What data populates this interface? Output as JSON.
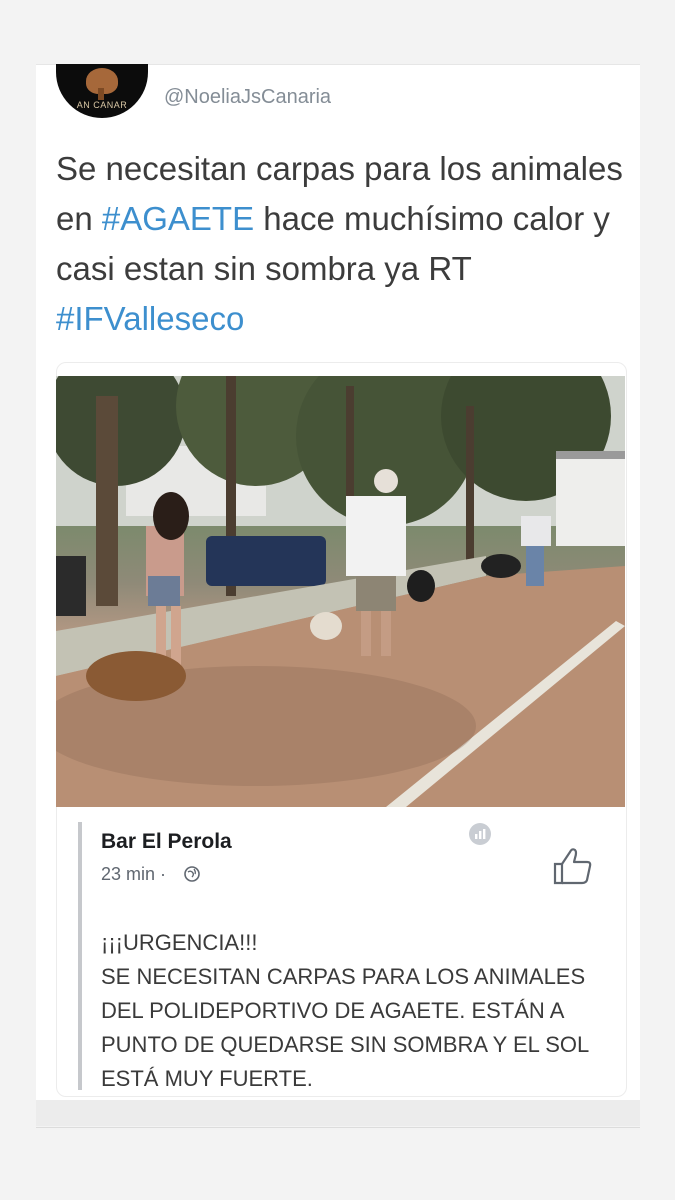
{
  "tweet": {
    "handle": "@NoeliaJsCanaria",
    "avatar_text": "AN CANAR",
    "text_prefix": "Se necesitan carpas para los animales en ",
    "hashtag1": "#AGAETE",
    "text_middle": " hace muchísimo calor y casi estan sin sombra ya RT  ",
    "hashtag2": "#IFValleseco"
  },
  "facebook_post": {
    "page_name": "Bar El Perola",
    "time": "23 min ·",
    "body_line1": "¡¡¡URGENCIA!!!",
    "body_rest": "SE NECESITAN CARPAS PARA LOS ANIMALES DEL POLIDEPORTIVO DE AGAETE. ESTÁN A PUNTO DE QUEDARSE SIN SOMBRA Y EL SOL ESTÁ MUY FUERTE."
  },
  "icons": [
    "globe-icon",
    "info-icon",
    "thumbs-up-icon"
  ],
  "colors": {
    "hashtag": "#3d8fce",
    "handle": "#848d96",
    "text": "#3c3c3c"
  }
}
